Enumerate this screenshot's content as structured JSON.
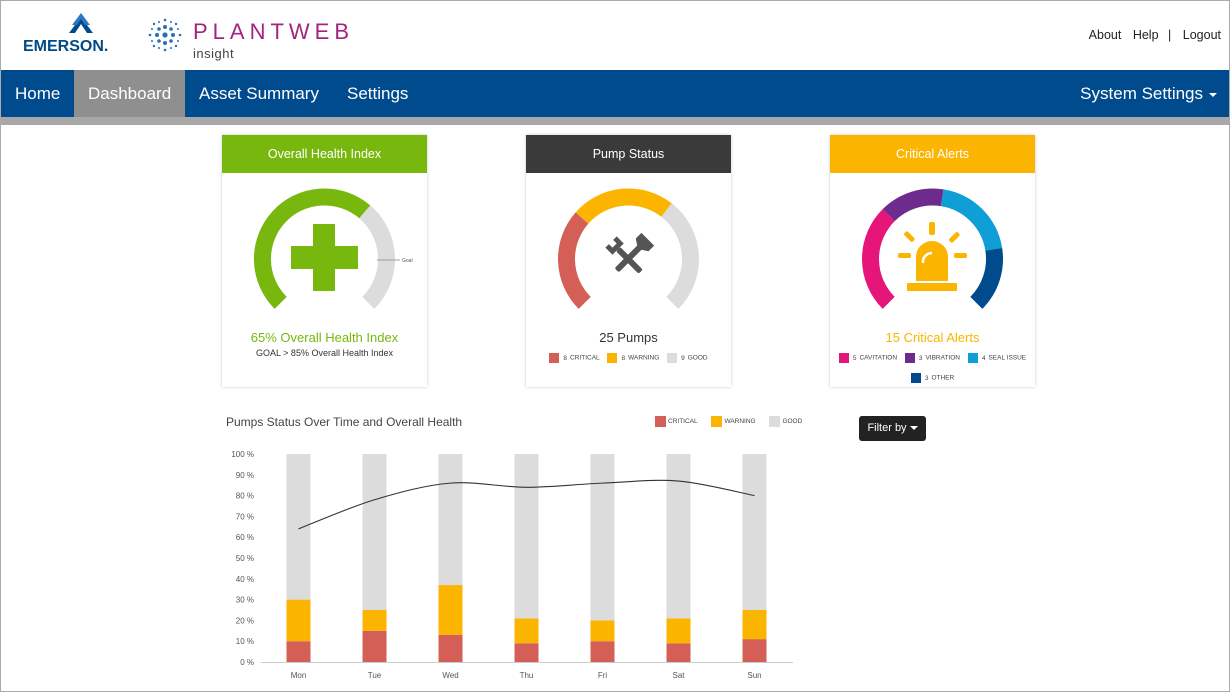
{
  "header": {
    "emerson_logo_text": "EMERSON.",
    "plantweb_title": "PLANTWEB",
    "plantweb_subtitle": "insight",
    "links": [
      "About",
      "Help",
      "|",
      "Logout"
    ]
  },
  "nav": {
    "items": [
      {
        "label": "Home",
        "active": false
      },
      {
        "label": "Dashboard",
        "active": true
      },
      {
        "label": "Asset Summary",
        "active": false
      },
      {
        "label": "Settings",
        "active": false
      }
    ],
    "system_settings": "System Settings"
  },
  "cards": {
    "health": {
      "header": "Overall Health Index",
      "header_color": "#78b80e",
      "value_percent": 65,
      "goal_label": "Goal",
      "title": "65% Overall Health Index",
      "subtitle": "GOAL > 85% Overall Health Index",
      "accent": "#78b80e",
      "icon": "medical-cross-icon"
    },
    "pump": {
      "header": "Pump Status",
      "header_color": "#3a3a3a",
      "title": "25 Pumps",
      "icon": "tools-icon",
      "legend": [
        {
          "count": "8",
          "label": "CRITICAL",
          "color": "#d35f57"
        },
        {
          "count": "8",
          "label": "WARNING",
          "color": "#fbb400"
        },
        {
          "count": "9",
          "label": "GOOD",
          "color": "#dcdcdc"
        }
      ]
    },
    "alerts": {
      "header": "Critical Alerts",
      "header_color": "#fbb400",
      "title": "15 Critical Alerts",
      "icon": "alarm-beacon-icon",
      "legend": [
        {
          "count": "5",
          "label": "CAVITATION",
          "color": "#e5157a"
        },
        {
          "count": "3",
          "label": "VIBRATION",
          "color": "#6e2b8e"
        },
        {
          "count": "4",
          "label": "SEAL ISSUE",
          "color": "#0f9ed5"
        },
        {
          "count": "3",
          "label": "OTHER",
          "color": "#004b8d"
        }
      ]
    }
  },
  "chart_section": {
    "title": "Pumps Status Over Time and Overall Health",
    "filter_label": "Filter by"
  },
  "chart_data": {
    "type": "bar",
    "stacked": true,
    "categories": [
      "Mon",
      "Tue",
      "Wed",
      "Thu",
      "Fri",
      "Sat",
      "Sun"
    ],
    "series": [
      {
        "name": "CRITICAL",
        "color": "#d35f57",
        "values": [
          10,
          15,
          13,
          9,
          10,
          9,
          11
        ]
      },
      {
        "name": "WARNING",
        "color": "#fbb400",
        "values": [
          20,
          10,
          24,
          12,
          10,
          12,
          14
        ]
      },
      {
        "name": "GOOD",
        "color": "#dcdcdc",
        "values": [
          70,
          75,
          63,
          79,
          80,
          79,
          75
        ]
      }
    ],
    "line": {
      "color": "#333333",
      "values": [
        64,
        78,
        86,
        84,
        86,
        87,
        80
      ]
    },
    "y_ticks": [
      "0 %",
      "10 %",
      "20 %",
      "30 %",
      "40 %",
      "50 %",
      "60 %",
      "70 %",
      "80 %",
      "90 %",
      "100 %"
    ],
    "ylim": [
      0,
      100
    ],
    "legend_position": "top-right"
  }
}
